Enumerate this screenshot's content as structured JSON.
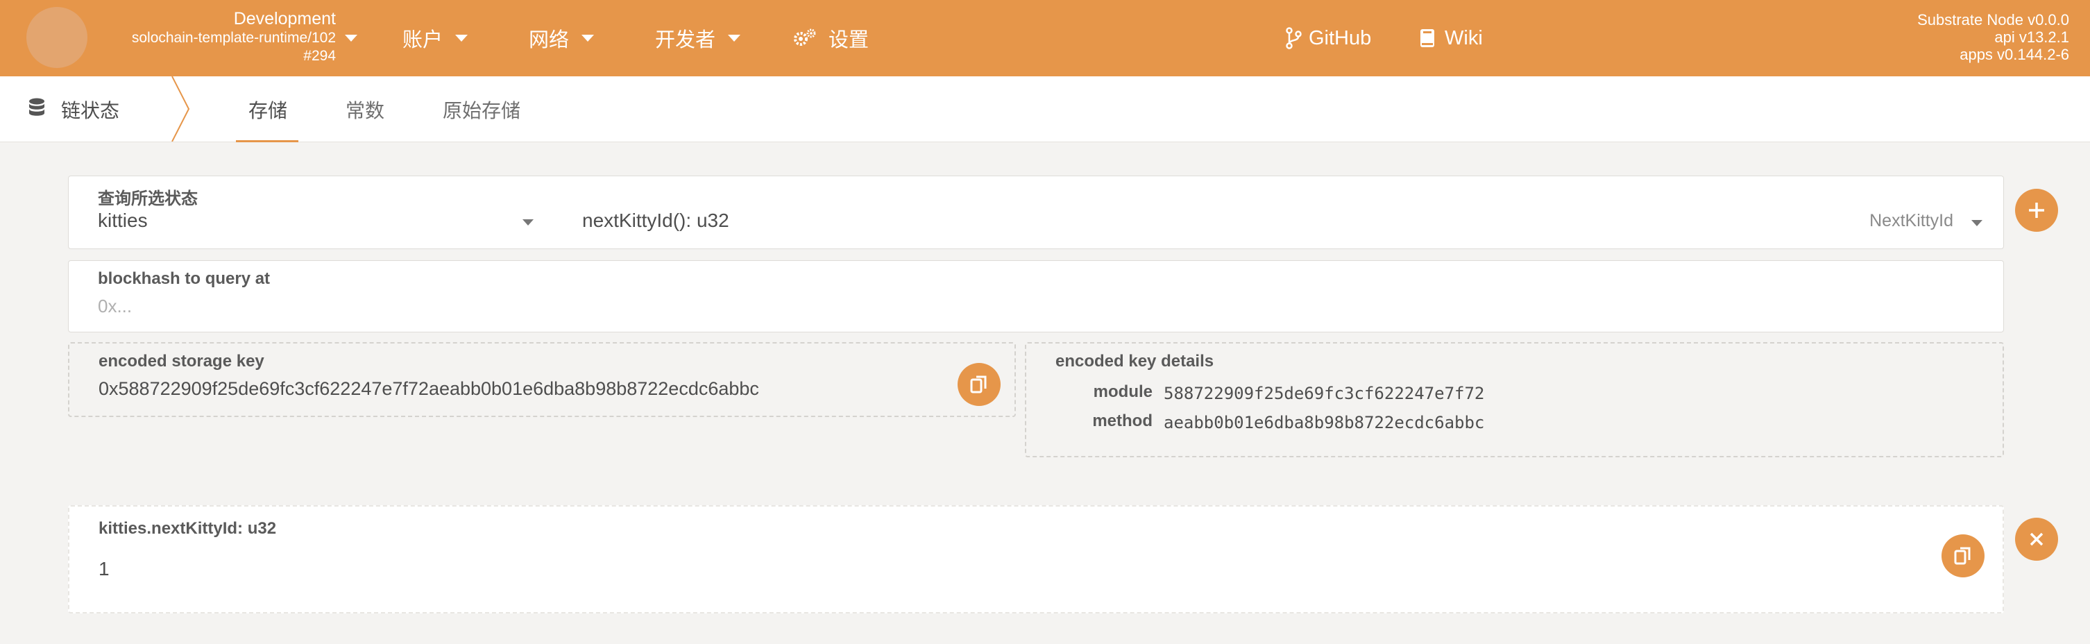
{
  "header": {
    "chain_name": "Development",
    "runtime": "solochain-template-runtime/102",
    "block": "#294",
    "nav": [
      {
        "label": "账户"
      },
      {
        "label": "网络"
      },
      {
        "label": "开发者"
      },
      {
        "label": "设置"
      }
    ],
    "links": [
      {
        "label": "GitHub"
      },
      {
        "label": "Wiki"
      }
    ],
    "version": {
      "node": "Substrate Node v0.0.0",
      "api": "api v13.2.1",
      "apps": "apps v0.144.2-6"
    },
    "accent_color": "#e6964a"
  },
  "subnav": {
    "title": "链状态",
    "tabs": [
      {
        "label": "存储",
        "active": true
      },
      {
        "label": "常数",
        "active": false
      },
      {
        "label": "原始存储",
        "active": false
      }
    ]
  },
  "query": {
    "label": "查询所选状态",
    "module": "kitties",
    "method_signature": "nextKittyId(): u32",
    "method_name": "NextKittyId"
  },
  "blockhash": {
    "label": "blockhash to query at",
    "placeholder": "0x..."
  },
  "encoded": {
    "label": "encoded storage key",
    "value": "0x588722909f25de69fc3cf622247e7f72aeabb0b01e6dba8b98b8722ecdc6abbc",
    "details_label": "encoded key details",
    "module_label": "module",
    "module_value": "588722909f25de69fc3cf622247e7f72",
    "method_label": "method",
    "method_value": "aeabb0b01e6dba8b98b8722ecdc6abbc"
  },
  "result": {
    "label": "kitties.nextKittyId: u32",
    "value": "1"
  },
  "icons": {
    "add": "plus-icon",
    "remove": "close-icon",
    "copy": "copy-icon",
    "settings": "gear-icon",
    "github": "branch-icon",
    "wiki": "book-icon",
    "chain_state": "database-icon"
  }
}
